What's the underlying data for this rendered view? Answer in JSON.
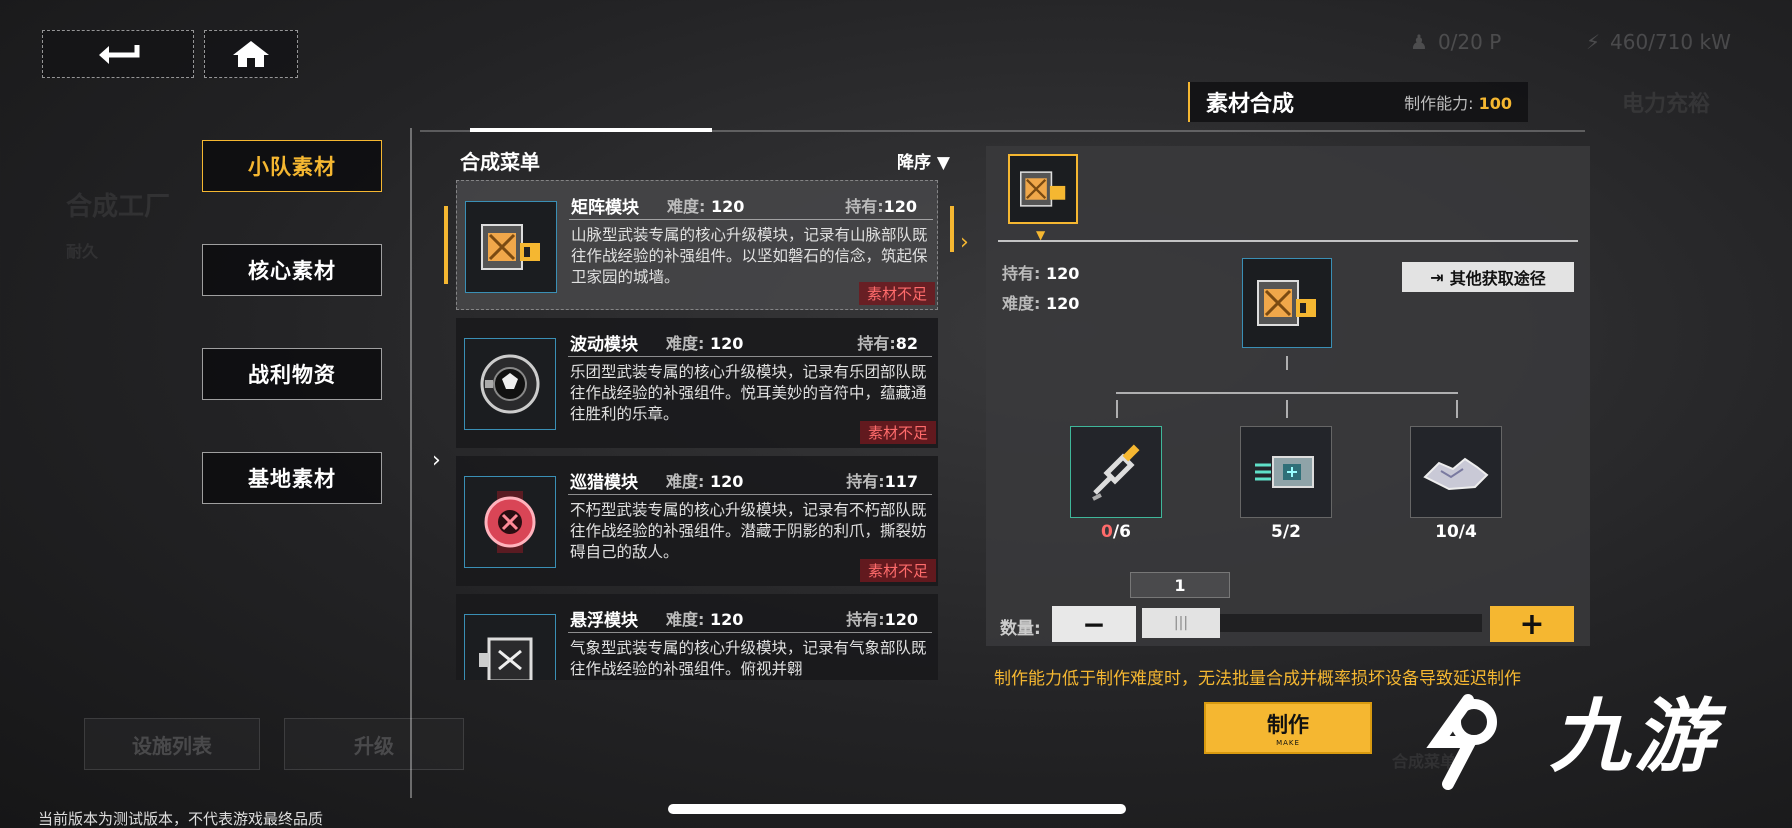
{
  "bg": {
    "factory_title": "合成工厂",
    "durability_label": "耐久",
    "power_status": "电力充裕",
    "facility_list": "设施列表",
    "upgrade": "升级",
    "recipe_menu_ghost": "合成菜单"
  },
  "status": {
    "people": "0/20 P",
    "power": "460/710 kW"
  },
  "header": {
    "title": "素材合成",
    "capability_label": "制作能力:",
    "capability_value": "100"
  },
  "categories": [
    {
      "label": "小队素材",
      "active": true
    },
    {
      "label": "核心素材",
      "active": false
    },
    {
      "label": "战利物资",
      "active": false
    },
    {
      "label": "基地素材",
      "active": false
    }
  ],
  "recipe_list": {
    "title": "合成菜单",
    "sort_label": "降序",
    "items": [
      {
        "name": "矩阵模块",
        "difficulty_label": "难度:",
        "difficulty": "120",
        "own_label": "持有:",
        "own": "120",
        "desc": "山脉型武装专属的核心升级模块，记录有山脉部队既往作战经验的补强组件。以坚如磐石的信念，筑起保卫家园的城墙。",
        "lack": "素材不足"
      },
      {
        "name": "波动模块",
        "difficulty_label": "难度:",
        "difficulty": "120",
        "own_label": "持有:",
        "own": "82",
        "desc": "乐团型武装专属的核心升级模块，记录有乐团部队既往作战经验的补强组件。悦耳美妙的音符中，蕴藏通往胜利的乐章。",
        "lack": "素材不足"
      },
      {
        "name": "巡猎模块",
        "difficulty_label": "难度:",
        "difficulty": "120",
        "own_label": "持有:",
        "own": "117",
        "desc": "不朽型武装专属的核心升级模块，记录有不朽部队既往作战经验的补强组件。潜藏于阴影的利爪，撕裂妨碍自己的敌人。",
        "lack": "素材不足"
      },
      {
        "name": "悬浮模块",
        "difficulty_label": "难度:",
        "difficulty": "120",
        "own_label": "持有:",
        "own": "120",
        "desc": "气象型武装专属的核心升级模块，记录有气象部队既往作战经验的补强组件。俯视并翱",
        "lack": ""
      }
    ]
  },
  "detail": {
    "own_label": "持有:",
    "own": "120",
    "difficulty_label": "难度:",
    "difficulty": "120",
    "other_source": "其他获取途径",
    "ingredients": [
      {
        "have": "0",
        "need": "6",
        "icon": "syringe-gun-icon",
        "insufficient": true
      },
      {
        "have": "5",
        "need": "2",
        "icon": "circuit-chip-icon",
        "insufficient": false
      },
      {
        "have": "10",
        "need": "4",
        "icon": "metal-fragment-icon",
        "insufficient": false
      }
    ],
    "quantity_label": "数量:",
    "quantity": "1",
    "warning": "制作能力低于制作难度时，无法批量合成并概率损坏设备导致延迟制作",
    "make_label": "制作",
    "make_sub": "MAKE"
  },
  "watermark": "九游",
  "footer": "当前版本为测试版本，不代表游戏最终品质",
  "colors": {
    "accent": "#f5b731",
    "danger": "#ff6b6b",
    "item_border": "#3a8fb5"
  }
}
